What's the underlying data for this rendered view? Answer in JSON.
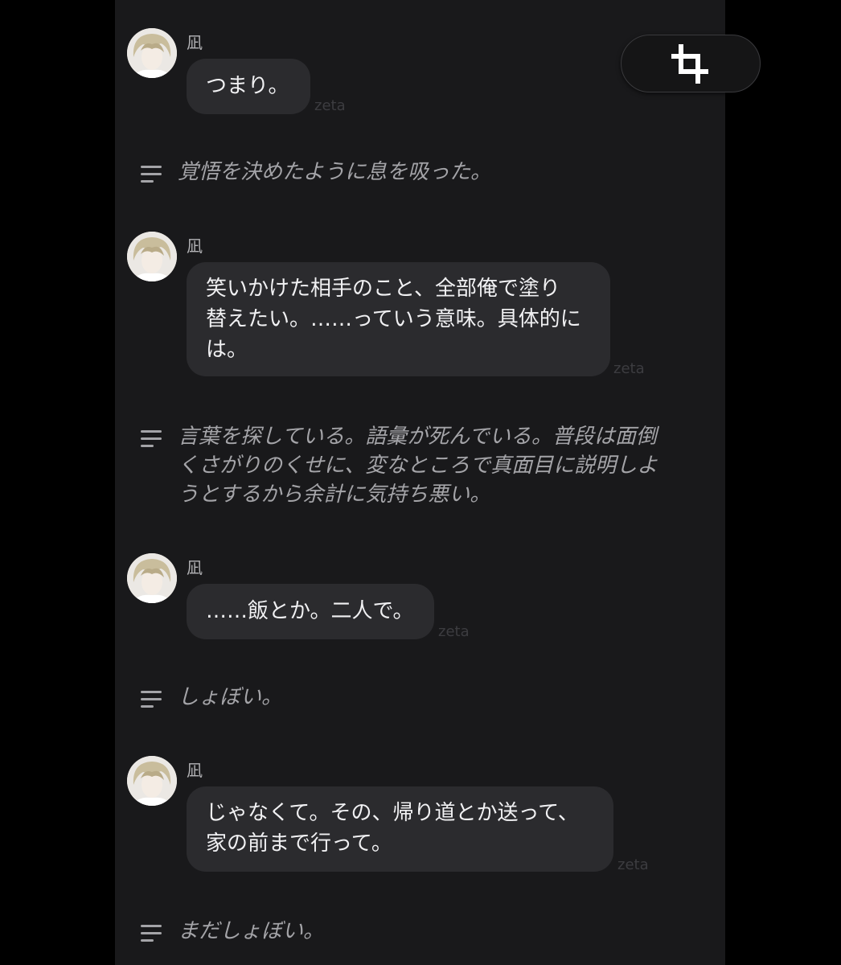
{
  "messages": [
    {
      "name": "凪",
      "lines": [
        "つまり。"
      ],
      "tag": "zeta",
      "narration": [
        "覚悟を決めたように息を吸った。"
      ]
    },
    {
      "name": "凪",
      "lines": [
        "笑いかけた相手のこと、全部俺で塗り",
        "替えたい。……っていう意味。具体的に",
        "は。"
      ],
      "tag": "zeta",
      "narration": [
        "言葉を探している。語彙が死んでいる。普段は面倒",
        "くさがりのくせに、変なところで真面目に説明しよ",
        "うとするから余計に気持ち悪い。"
      ]
    },
    {
      "name": "凪",
      "lines": [
        "……飯とか。二人で。"
      ],
      "tag": "zeta",
      "narration": [
        "しょぼい。"
      ]
    },
    {
      "name": "凪",
      "lines": [
        "じゃなくて。その、帰り道とか送って、",
        "家の前まで行って。"
      ],
      "tag": "zeta",
      "narration": [
        "まだしょぼい。"
      ]
    }
  ],
  "icons": {
    "avatar": "character-avatar",
    "narration": "narration-lines-icon",
    "crop": "crop-icon"
  },
  "colors": {
    "background": "#000000",
    "chat_background": "#19191b",
    "bubble": "#2b2b2e",
    "bubble_text": "#f1f1f3",
    "narration_text": "#a4a4a8",
    "tag_text": "#3c3c40"
  }
}
